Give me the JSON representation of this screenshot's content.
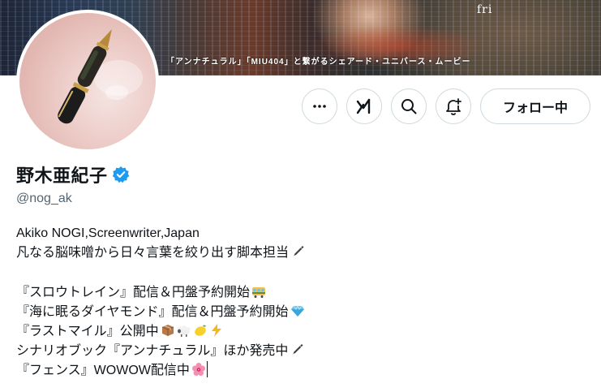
{
  "banner": {
    "date_text": "fri",
    "caption": "「アンナチュラル」「MIU404」と繋がるシェアード・ユニバース・ムービー"
  },
  "actions": {
    "more_icon": "ellipsis-icon",
    "grok_icon": "grok-icon",
    "search_icon": "search-icon",
    "notify_icon": "bell-plus-icon",
    "follow_label": "フォロー中"
  },
  "profile": {
    "display_name": "野木亜紀子",
    "verified": true,
    "verified_color": "#1d9bf0",
    "handle": "@nog_ak"
  },
  "bio": {
    "line1": "Akiko NOGI,Screenwriter,Japan",
    "line2": "凡なる脳味噌から日々言葉を絞り出す脚本担当",
    "line2_emoji": "pen-icon",
    "line3": "『スロウトレイン』配信＆円盤予約開始",
    "line3_emoji": "train-icon",
    "line4": "『海に眠るダイヤモンド』配信＆円盤予約開始",
    "line4_emoji": "diamond-icon",
    "line5": "『ラストマイル』公開中",
    "line5_emoji": [
      "package-icon",
      "sheep-icon",
      "lemon-icon",
      "lightning-icon"
    ],
    "line6": "シナリオブック『アンナチュラル』ほか発売中",
    "line6_emoji": "pen-icon",
    "line7": "『フェンス』WOWOW配信中",
    "line7_emoji": "hibiscus-icon"
  },
  "colors": {
    "text": "#0f1419",
    "secondary": "#536471",
    "border": "#cfd9de"
  }
}
